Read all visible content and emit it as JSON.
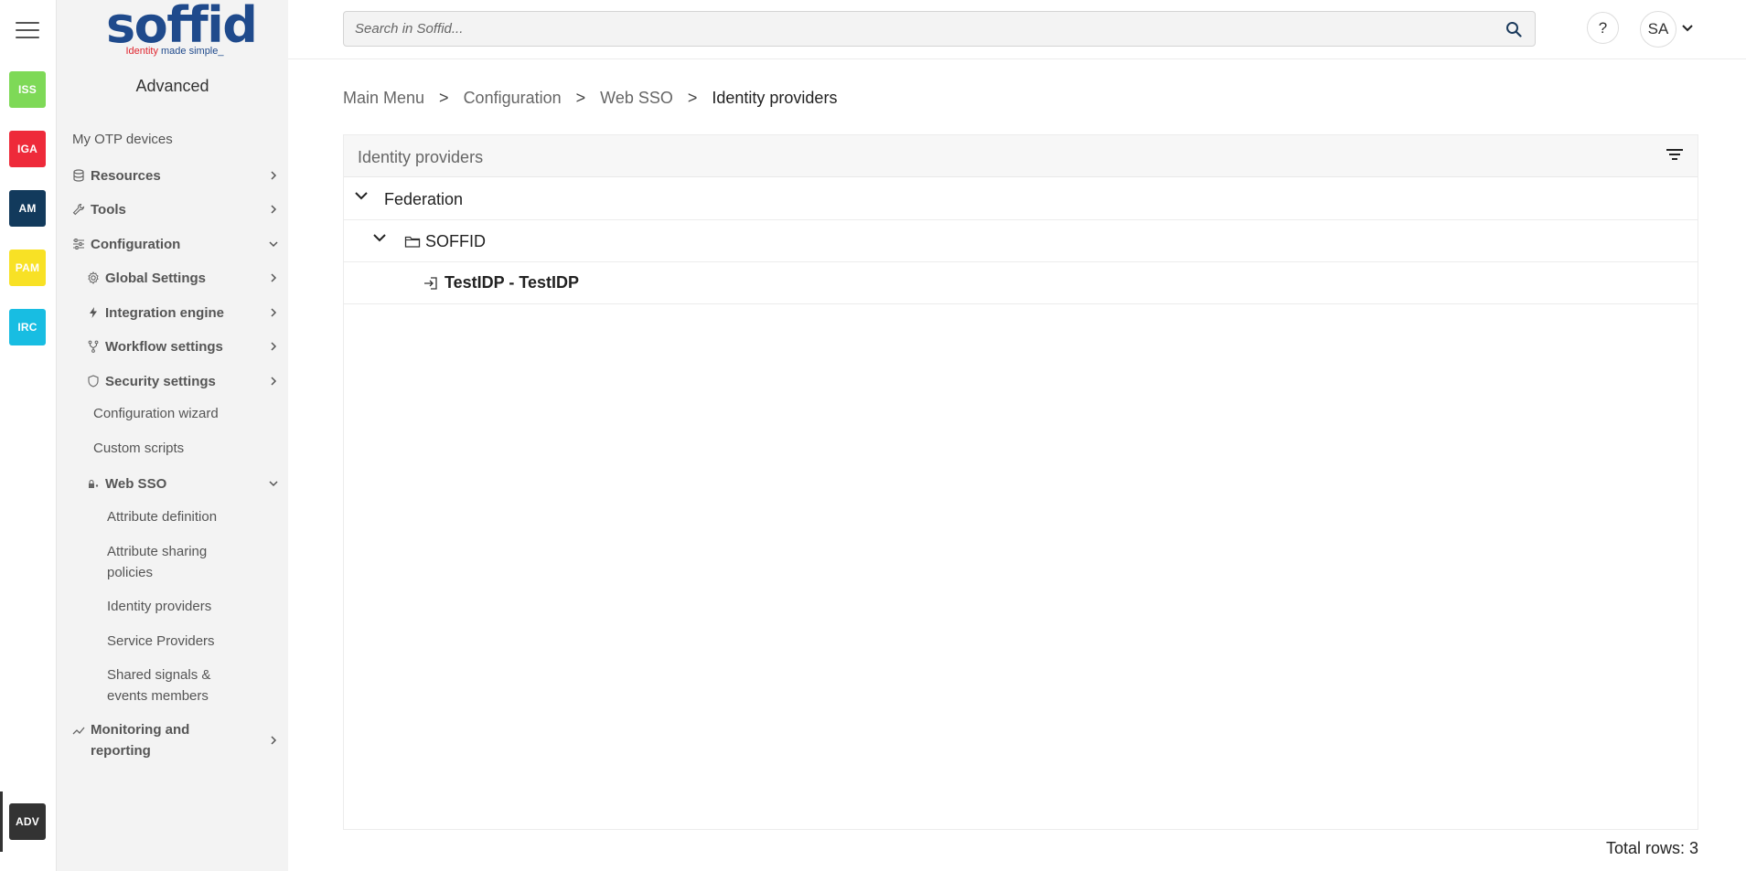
{
  "rail": {
    "badges": [
      {
        "label": "ISS",
        "color": "#7ed957"
      },
      {
        "label": "IGA",
        "color": "#ee2a3a"
      },
      {
        "label": "AM",
        "color": "#123a5c"
      },
      {
        "label": "PAM",
        "color": "#f8e125"
      },
      {
        "label": "IRC",
        "color": "#18bde2"
      },
      {
        "label": "ADV",
        "color": "#333333"
      }
    ]
  },
  "logo": {
    "word": "soffid",
    "tag_red": "Identity",
    "tag_rest": " made simple_"
  },
  "sidebar": {
    "section_title": "Advanced",
    "items": {
      "otp": "My OTP devices",
      "resources": "Resources",
      "tools": "Tools",
      "configuration": "Configuration",
      "global_settings": "Global Settings",
      "integration_engine": "Integration engine",
      "workflow_settings": "Workflow settings",
      "security_settings": "Security settings",
      "configuration_wizard": "Configuration wizard",
      "custom_scripts": "Custom scripts",
      "web_sso": "Web SSO",
      "attribute_definition": "Attribute definition",
      "attribute_sharing_1": "Attribute sharing",
      "attribute_sharing_2": "policies",
      "identity_providers": "Identity providers",
      "service_providers": "Service Providers",
      "shared_signals_1": "Shared signals &",
      "shared_signals_2": "events members",
      "monitoring_1": "Monitoring and",
      "monitoring_2": "reporting"
    }
  },
  "header": {
    "search_placeholder": "Search in Soffid...",
    "help_label": "?",
    "avatar_initials": "SA"
  },
  "breadcrumb": {
    "items": [
      "Main Menu",
      "Configuration",
      "Web SSO"
    ],
    "current": "Identity providers",
    "separator": ">"
  },
  "panel": {
    "title": "Identity providers",
    "tree": {
      "federation": "Federation",
      "soffid": "SOFFID",
      "testidp": "TestIDP - TestIDP"
    },
    "total_rows": "Total rows: 3"
  }
}
